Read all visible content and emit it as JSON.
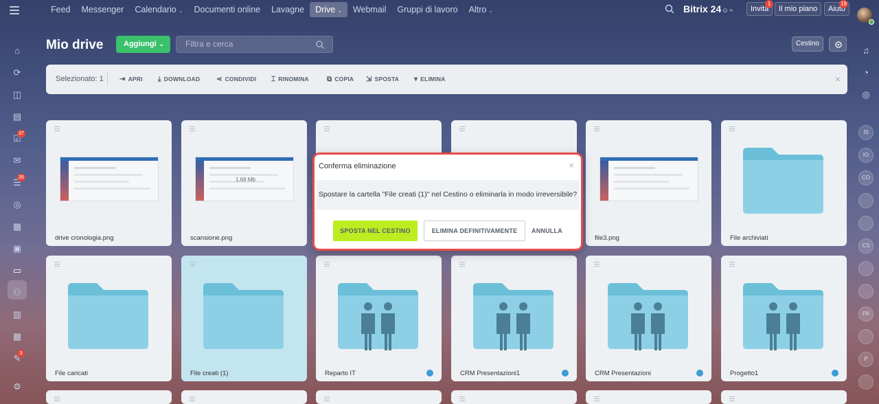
{
  "topnav": {
    "items": [
      {
        "label": "Feed",
        "dropdown": false,
        "active": false
      },
      {
        "label": "Messenger",
        "dropdown": false,
        "active": false
      },
      {
        "label": "Calendario",
        "dropdown": true,
        "active": false
      },
      {
        "label": "Documenti online",
        "dropdown": false,
        "active": false
      },
      {
        "label": "Lavagne",
        "dropdown": false,
        "active": false
      },
      {
        "label": "Drive",
        "dropdown": true,
        "active": true
      },
      {
        "label": "Webmail",
        "dropdown": false,
        "active": false
      },
      {
        "label": "Gruppi di lavoro",
        "dropdown": false,
        "active": false
      },
      {
        "label": "Altro",
        "dropdown": true,
        "active": false
      }
    ],
    "brand": "Bitrix 24",
    "invite_label": "Invita",
    "invite_badge": "1",
    "plan_label": "Il mio piano",
    "help_label": "Aiuto",
    "help_badge": "19"
  },
  "leftbar_badges": {
    "tasks": "37",
    "feed": "35",
    "approvals": "3"
  },
  "page": {
    "title": "Mio drive",
    "add_button": "Aggiungi",
    "filter_placeholder": "Filtra e cerca",
    "trash_button": "Cestino"
  },
  "toolbar": {
    "selected": "Selezionato: 1",
    "actions": [
      {
        "label": "APRI",
        "icon": "open-icon"
      },
      {
        "label": "DOWNLOAD",
        "icon": "download-icon"
      },
      {
        "label": "CONDIVIDI",
        "icon": "share-icon"
      },
      {
        "label": "RINOMINA",
        "icon": "rename-icon"
      },
      {
        "label": "COPIA",
        "icon": "copy-icon"
      },
      {
        "label": "SPOSTA",
        "icon": "move-icon"
      },
      {
        "label": "ELIMINA",
        "icon": "delete-icon"
      }
    ]
  },
  "cards_row1": [
    {
      "name": "drive cronologia.png",
      "type": "image"
    },
    {
      "name": "scansione.png",
      "type": "image",
      "thumb_text": "1.68 Mb"
    },
    {
      "name": "",
      "type": "image"
    },
    {
      "name": "",
      "type": "image"
    },
    {
      "name": "file3.png",
      "type": "image"
    },
    {
      "name": "File archiviati",
      "type": "folder"
    }
  ],
  "cards_row2": [
    {
      "name": "File caricati",
      "type": "folder",
      "shared": false,
      "selected": false
    },
    {
      "name": "File creati (1)",
      "type": "folder",
      "shared": false,
      "selected": true
    },
    {
      "name": "Reparto IT",
      "type": "group-folder",
      "shared": true,
      "selected": false
    },
    {
      "name": "CRM Presentazioni1",
      "type": "group-folder",
      "shared": true,
      "selected": false
    },
    {
      "name": "CRM Presentazioni",
      "type": "group-folder",
      "shared": true,
      "selected": false
    },
    {
      "name": "Progetto1",
      "type": "group-folder",
      "shared": true,
      "selected": false
    }
  ],
  "rightbar": [
    "IS",
    "IO",
    "CO",
    "",
    "",
    "CS",
    "",
    "",
    "PA",
    "",
    "P",
    ""
  ],
  "modal": {
    "title": "Conferma eliminazione",
    "message": "Spostare la cartella \"File creati (1)\" nel Cestino o eliminarla in modo irreversibile?",
    "btn_trash": "SPOSTA NEL CESTINO",
    "btn_delete": "ELIMINA DEFINITIVAMENTE",
    "btn_cancel": "ANNULLA"
  },
  "colors": {
    "accent_green": "#3bc16b",
    "confirm_lime": "#bbed21",
    "highlight_red": "#e84a4a",
    "folder_blue": "#6bbfd9"
  }
}
